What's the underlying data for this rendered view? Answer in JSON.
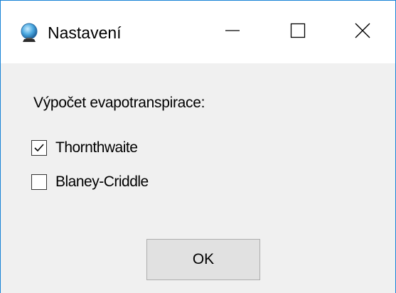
{
  "window": {
    "title": "Nastavení",
    "icon": "globe-icon",
    "controls": {
      "minimize_icon": "minimize-icon",
      "maximize_icon": "maximize-icon",
      "close_icon": "close-icon"
    }
  },
  "form": {
    "group_label": "Výpočet evapotranspirace:",
    "options": [
      {
        "label": "Thornthwaite",
        "checked": true
      },
      {
        "label": "Blaney-Criddle",
        "checked": false
      }
    ],
    "ok_label": "OK"
  },
  "colors": {
    "window_border": "#1883d7",
    "titlebar_bg": "#ffffff",
    "client_bg": "#f0f0f0",
    "button_bg": "#e1e1e1",
    "button_border": "#adadad"
  }
}
